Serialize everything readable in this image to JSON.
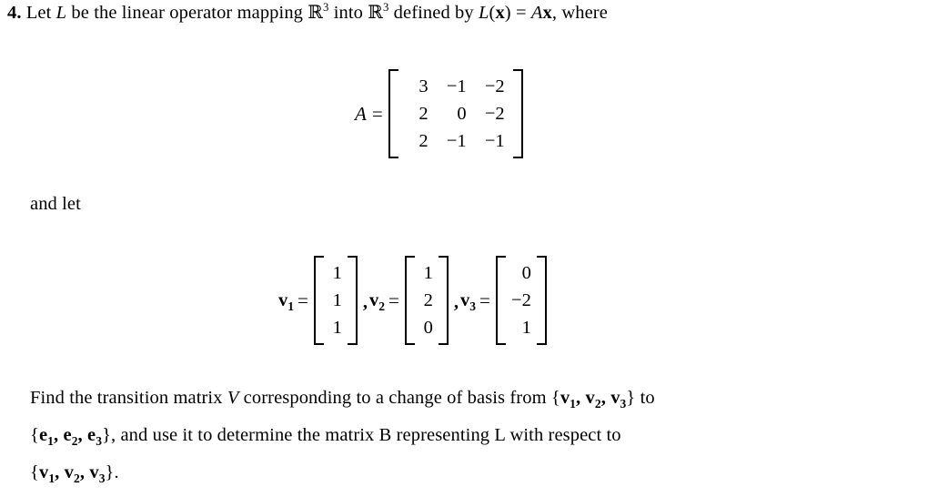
{
  "document": {
    "background_color": "#ffffff",
    "text_color": "#000000",
    "problem_number": "4.",
    "intro": {
      "part1": "Let",
      "operator_symbol": "L",
      "part2": "be the linear operator mapping",
      "domain_symbol": "R",
      "domain_exponent": "3",
      "part3": "into",
      "codomain_symbol": "R",
      "codomain_exponent": "3",
      "part4": "defined by",
      "def_L": "L",
      "def_open": "(",
      "def_x": "x",
      "def_close": ")",
      "def_equals": "=",
      "def_A": "A",
      "def_x2": "x",
      "def_comma": ",",
      "part5": "where"
    },
    "matrix_A": {
      "label": "A",
      "equals": "=",
      "rows": [
        [
          "3",
          "−1",
          "−2"
        ],
        [
          "2",
          "0",
          "−2"
        ],
        [
          "2",
          "−1",
          "−1"
        ]
      ]
    },
    "and_let_text": "and let",
    "vectors": [
      {
        "name": "v",
        "index": "1",
        "equals": "=",
        "entries": [
          "1",
          "1",
          "1"
        ],
        "separator": ""
      },
      {
        "name": "v",
        "index": "2",
        "equals": "=",
        "entries": [
          "1",
          "2",
          "0"
        ],
        "separator": ","
      },
      {
        "name": "v",
        "index": "3",
        "equals": "=",
        "entries": [
          "0",
          "−2",
          "1"
        ],
        "separator": ","
      }
    ],
    "question": {
      "line1_a": "Find the transition matrix",
      "line1_V": "V",
      "line1_b": "corresponding to a change of basis from",
      "line1_set_open": "{",
      "line1_v1": "v",
      "line1_v1_sub": "1",
      "line1_comma1": ",",
      "line1_v2": "v",
      "line1_v2_sub": "2",
      "line1_comma2": ",",
      "line1_v3": "v",
      "line1_v3_sub": "3",
      "line1_set_close": "}",
      "line1_c": "to",
      "line2_set_open": "{",
      "line2_e1": "e",
      "line2_e1_sub": "1",
      "line2_comma1": ",",
      "line2_e2": "e",
      "line2_e2_sub": "2",
      "line2_comma2": ",",
      "line2_e3": "e",
      "line2_e3_sub": "3",
      "line2_set_close": "}",
      "line2_rest": ", and use it to determine the matrix B representing L with respect to",
      "line3_set_open": "{",
      "line3_v1": "v",
      "line3_v1_sub": "1",
      "line3_comma1": ",",
      "line3_v2": "v",
      "line3_v2_sub": "2",
      "line3_comma2": ",",
      "line3_v3": "v",
      "line3_v3_sub": "3",
      "line3_set_close": "}",
      "line3_period": "."
    }
  }
}
